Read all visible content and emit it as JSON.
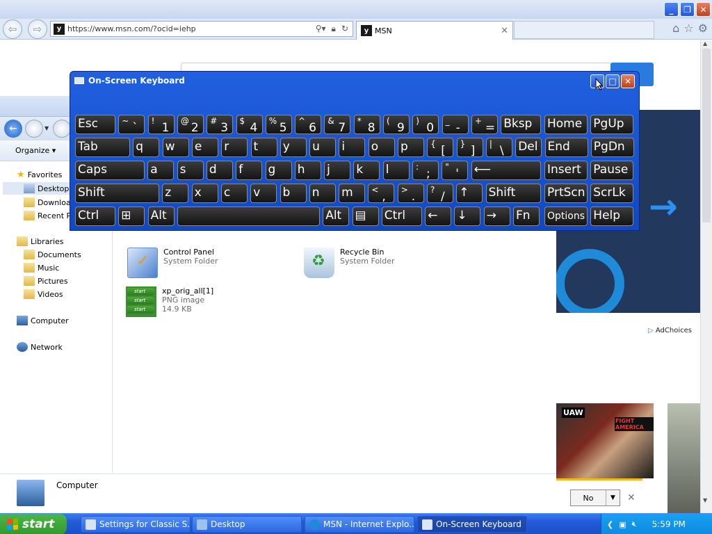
{
  "ie": {
    "url": "https://www.msn.com/?ocid=iehp",
    "tab_label": "MSN",
    "favicon": "msn-icon"
  },
  "msn": {
    "adchoices": "AdChoices",
    "notification_select": "No",
    "photo_text": [
      "UAW",
      "FIGHT AMERICA"
    ]
  },
  "explorer": {
    "organize": "Organize ▾",
    "nav": {
      "favorites": "Favorites",
      "desktop": "Desktop",
      "downloads": "Download",
      "recent": "Recent Pl",
      "libraries": "Libraries",
      "documents": "Documents",
      "music": "Music",
      "pictures": "Pictures",
      "videos": "Videos",
      "computer": "Computer",
      "network": "Network"
    },
    "items": [
      {
        "name": "Control Panel",
        "type": "System Folder"
      },
      {
        "name": "Recycle Bin",
        "type": "System Folder"
      },
      {
        "name": "xp_orig_all[1]",
        "type": "PNG image",
        "size": "14.9 KB"
      }
    ],
    "xp_thumb_label": "start",
    "details_label": "Computer"
  },
  "osk": {
    "title": "On-Screen Keyboard",
    "rows": [
      [
        {
          "main": "Esc"
        },
        {
          "shift": "~",
          "main": "`"
        },
        {
          "shift": "!",
          "main": "1"
        },
        {
          "shift": "@",
          "main": "2"
        },
        {
          "shift": "#",
          "main": "3"
        },
        {
          "shift": "$",
          "main": "4"
        },
        {
          "shift": "%",
          "main": "5"
        },
        {
          "shift": "^",
          "main": "6"
        },
        {
          "shift": "&",
          "main": "7"
        },
        {
          "shift": "*",
          "main": "8"
        },
        {
          "shift": "(",
          "main": "9"
        },
        {
          "shift": ")",
          "main": "0"
        },
        {
          "shift": "_",
          "main": "-"
        },
        {
          "shift": "+",
          "main": "="
        },
        {
          "main": "Bksp"
        },
        {
          "main": "Home"
        },
        {
          "main": "PgUp"
        }
      ],
      [
        {
          "main": "Tab"
        },
        {
          "main": "q"
        },
        {
          "main": "w"
        },
        {
          "main": "e"
        },
        {
          "main": "r"
        },
        {
          "main": "t"
        },
        {
          "main": "y"
        },
        {
          "main": "u"
        },
        {
          "main": "i"
        },
        {
          "main": "o"
        },
        {
          "main": "p"
        },
        {
          "shift": "{",
          "main": "["
        },
        {
          "shift": "}",
          "main": "]"
        },
        {
          "shift": "|",
          "main": "\\"
        },
        {
          "main": "Del"
        },
        {
          "main": "End"
        },
        {
          "main": "PgDn"
        }
      ],
      [
        {
          "main": "Caps"
        },
        {
          "main": "a"
        },
        {
          "main": "s"
        },
        {
          "main": "d"
        },
        {
          "main": "f"
        },
        {
          "main": "g"
        },
        {
          "main": "h"
        },
        {
          "main": "j"
        },
        {
          "main": "k"
        },
        {
          "main": "l"
        },
        {
          "shift": ":",
          "main": ";"
        },
        {
          "shift": "\"",
          "main": "'"
        },
        {
          "main": "⟵"
        },
        {
          "main": "Insert"
        },
        {
          "main": "Pause"
        }
      ],
      [
        {
          "main": "Shift"
        },
        {
          "main": "z"
        },
        {
          "main": "x"
        },
        {
          "main": "c"
        },
        {
          "main": "v"
        },
        {
          "main": "b"
        },
        {
          "main": "n"
        },
        {
          "main": "m"
        },
        {
          "shift": "<",
          "main": ","
        },
        {
          "shift": ">",
          "main": "."
        },
        {
          "shift": "?",
          "main": "/"
        },
        {
          "main": "↑"
        },
        {
          "main": "Shift"
        },
        {
          "main": "PrtScn"
        },
        {
          "main": "ScrLk"
        }
      ],
      [
        {
          "main": "Ctrl"
        },
        {
          "main": "⊞"
        },
        {
          "main": "Alt"
        },
        {
          "main": ""
        },
        {
          "main": "Alt"
        },
        {
          "main": "▤"
        },
        {
          "main": "Ctrl"
        },
        {
          "main": "←"
        },
        {
          "main": "↓"
        },
        {
          "main": "→"
        },
        {
          "main": "Fn"
        },
        {
          "main": "Options"
        },
        {
          "main": "Help"
        }
      ]
    ]
  },
  "taskbar": {
    "start": "start",
    "buttons": [
      {
        "label": "Settings for Classic S...",
        "icon": "settings-window-icon"
      },
      {
        "label": "Desktop",
        "icon": "desktop-folder-icon"
      },
      {
        "label": "MSN - Internet Explo...",
        "icon": "ie-icon"
      },
      {
        "label": "On-Screen Keyboard",
        "icon": "keyboard-icon"
      }
    ],
    "clock": "5:59 PM"
  },
  "colors": {
    "osk_blue": "#1a52d0",
    "taskbar_blue": "#245ad8",
    "start_green": "#3aa832",
    "tray_blue": "#0d8ae0"
  }
}
